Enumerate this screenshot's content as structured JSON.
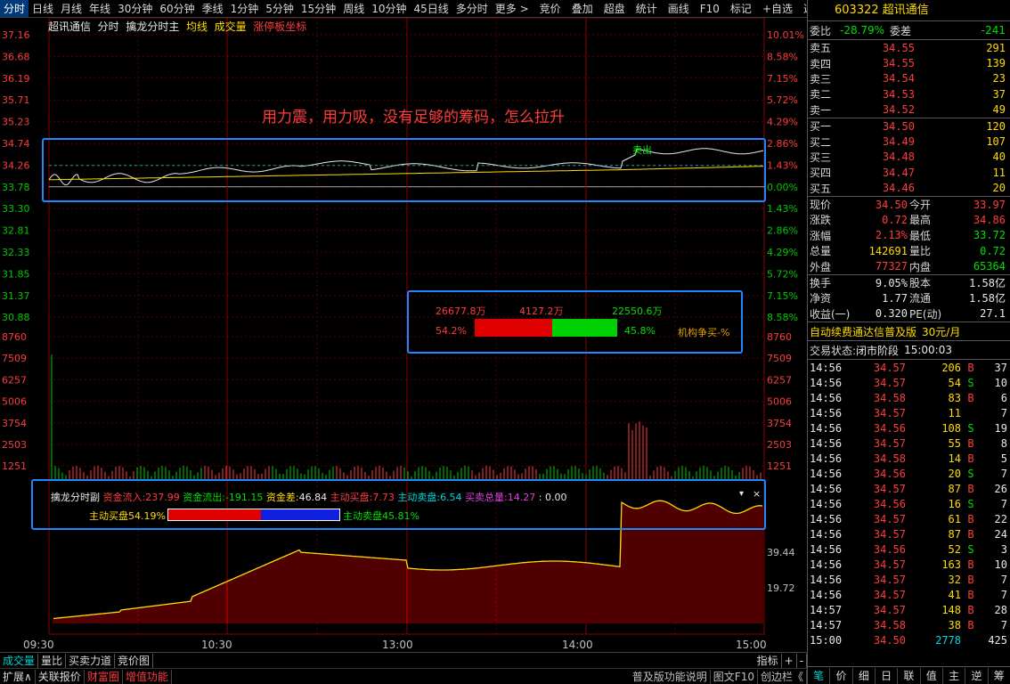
{
  "top_tabs": [
    "分时",
    "日线",
    "月线",
    "年线",
    "30分钟",
    "60分钟",
    "季线",
    "1分钟",
    "5分钟",
    "15分钟",
    "周线",
    "10分钟",
    "45日线",
    "多分时",
    "更多 >"
  ],
  "top_tools": [
    "竞价",
    "叠加",
    "超盘",
    "统计",
    "画线",
    "F10",
    "标记",
    "+自选",
    "返回"
  ],
  "info_bar": {
    "name": "超讯通信",
    "mode": "分时",
    "ind": "擒龙分时主",
    "avg": "均线",
    "vol": "成交量",
    "limit": "涨停板坐标"
  },
  "annotation_text": "用力震，用力吸，没有足够的筹码，怎么拉升",
  "price_axis_left": [
    "37.16",
    "36.68",
    "36.19",
    "35.71",
    "35.23",
    "34.74",
    "34.26",
    "33.78",
    "33.30",
    "32.81",
    "32.33",
    "31.85",
    "31.37",
    "30.88"
  ],
  "pct_axis_right": [
    "10.01%",
    "8.58%",
    "7.15%",
    "5.72%",
    "4.29%",
    "2.86%",
    "1.43%",
    "0.00%",
    "1.43%",
    "2.86%",
    "4.29%",
    "5.72%",
    "7.15%",
    "8.58%"
  ],
  "volume_axis": [
    "8760",
    "7509",
    "6257",
    "5006",
    "3754",
    "2503",
    "1251"
  ],
  "fund_axis": [
    "39.44",
    "19.72"
  ],
  "time_axis": [
    "09:30",
    "10:30",
    "13:00",
    "14:00",
    "15:00"
  ],
  "sell_label": "卖出",
  "flow_box": {
    "v1": "26677.8万",
    "v2": "4127.2万",
    "v3": "22550.6万",
    "p1": "54.2%",
    "p2": "45.8%",
    "note": "机构争买-%",
    "buy_frac": 0.542
  },
  "sub_panel": {
    "title": "擒龙分时副",
    "in_lbl": "资金流入:",
    "in_val": "237.99",
    "out_lbl": "资金流出:",
    "out_val": "-191.15",
    "diff_lbl": "资金差:",
    "diff_val": "46.84",
    "abuy_lbl": "主动买盘:",
    "abuy_val": "7.73",
    "asell_lbl": "主动卖盘:",
    "asell_val": "6.54",
    "total_lbl": "买卖总量:",
    "total_val": "14.27",
    "extra": ": 0.00",
    "buy_label": "主动买盘54.19%",
    "sell_label": "主动卖盘45.81%",
    "buy_frac": 0.5419
  },
  "bottom_tabs": [
    "成交量",
    "量比",
    "买卖力道",
    "竞价图"
  ],
  "bottom_right": [
    "指标",
    "+",
    "-"
  ],
  "status_left": [
    "扩展∧",
    "关联报价",
    "财富圈",
    "增值功能"
  ],
  "status_right": [
    "普及版功能说明",
    "图文F10",
    "创边栏《"
  ],
  "stock": {
    "code": "603322",
    "name": "超讯通信"
  },
  "webi": {
    "lbl": "委比",
    "val": "-28.79%",
    "lbl2": "委差",
    "val2": "-241"
  },
  "asks": [
    {
      "lbl": "卖五",
      "price": "34.55",
      "vol": "291"
    },
    {
      "lbl": "卖四",
      "price": "34.55",
      "vol": "139"
    },
    {
      "lbl": "卖三",
      "price": "34.54",
      "vol": "23"
    },
    {
      "lbl": "卖二",
      "price": "34.53",
      "vol": "37"
    },
    {
      "lbl": "卖一",
      "price": "34.52",
      "vol": "49"
    }
  ],
  "bids": [
    {
      "lbl": "买一",
      "price": "34.50",
      "vol": "120"
    },
    {
      "lbl": "买二",
      "price": "34.49",
      "vol": "107"
    },
    {
      "lbl": "买三",
      "price": "34.48",
      "vol": "40"
    },
    {
      "lbl": "买四",
      "price": "34.47",
      "vol": "11"
    },
    {
      "lbl": "买五",
      "price": "34.46",
      "vol": "20"
    }
  ],
  "quote": [
    {
      "l1": "现价",
      "v1": "34.50",
      "c1": "red",
      "l2": "今开",
      "v2": "33.97",
      "c2": "red"
    },
    {
      "l1": "涨跌",
      "v1": "0.72",
      "c1": "red",
      "l2": "最高",
      "v2": "34.86",
      "c2": "red"
    },
    {
      "l1": "涨幅",
      "v1": "2.13%",
      "c1": "red",
      "l2": "最低",
      "v2": "33.72",
      "c2": "green"
    },
    {
      "l1": "总量",
      "v1": "142691",
      "c1": "yellow",
      "l2": "量比",
      "v2": "0.72",
      "c2": "green"
    },
    {
      "l1": "外盘",
      "v1": "77327",
      "c1": "red",
      "l2": "内盘",
      "v2": "65364",
      "c2": "green"
    }
  ],
  "fin": [
    {
      "l1": "换手",
      "v1": "9.05%",
      "l2": "股本",
      "v2": "1.58亿"
    },
    {
      "l1": "净资",
      "v1": "1.77",
      "l2": "流通",
      "v2": "1.58亿"
    },
    {
      "l1": "收益(一)",
      "v1": "0.320",
      "l2": "PE(动)",
      "v2": "27.1"
    }
  ],
  "promo": {
    "text": "自动续费通达信普及版",
    "price": "30元/月"
  },
  "trade_state": {
    "lbl": "交易状态:",
    "state": "闭市阶段",
    "time": "15:00:03"
  },
  "ticks": [
    {
      "t": "14:56",
      "p": "34.57",
      "v": "206",
      "d": "B",
      "n": "37"
    },
    {
      "t": "14:56",
      "p": "34.57",
      "v": "54",
      "d": "S",
      "n": "10"
    },
    {
      "t": "14:56",
      "p": "34.58",
      "v": "83",
      "d": "B",
      "n": "6"
    },
    {
      "t": "14:56",
      "p": "34.57",
      "v": "11",
      "d": "",
      "n": "7"
    },
    {
      "t": "14:56",
      "p": "34.56",
      "v": "108",
      "d": "S",
      "n": "19"
    },
    {
      "t": "14:56",
      "p": "34.57",
      "v": "55",
      "d": "B",
      "n": "8"
    },
    {
      "t": "14:56",
      "p": "34.58",
      "v": "14",
      "d": "B",
      "n": "5"
    },
    {
      "t": "14:56",
      "p": "34.56",
      "v": "20",
      "d": "S",
      "n": "7"
    },
    {
      "t": "14:56",
      "p": "34.57",
      "v": "87",
      "d": "B",
      "n": "26"
    },
    {
      "t": "14:56",
      "p": "34.56",
      "v": "16",
      "d": "S",
      "n": "7"
    },
    {
      "t": "14:56",
      "p": "34.57",
      "v": "61",
      "d": "B",
      "n": "22"
    },
    {
      "t": "14:56",
      "p": "34.57",
      "v": "87",
      "d": "B",
      "n": "24"
    },
    {
      "t": "14:56",
      "p": "34.56",
      "v": "52",
      "d": "S",
      "n": "3"
    },
    {
      "t": "14:56",
      "p": "34.57",
      "v": "163",
      "d": "B",
      "n": "10"
    },
    {
      "t": "14:56",
      "p": "34.57",
      "v": "32",
      "d": "B",
      "n": "7"
    },
    {
      "t": "14:56",
      "p": "34.57",
      "v": "41",
      "d": "B",
      "n": "7"
    },
    {
      "t": "14:57",
      "p": "34.57",
      "v": "148",
      "d": "B",
      "n": "28"
    },
    {
      "t": "14:57",
      "p": "34.58",
      "v": "38",
      "d": "B",
      "n": "7"
    },
    {
      "t": "15:00",
      "p": "34.50",
      "v": "2778",
      "d": "",
      "n": "425"
    }
  ],
  "side_tabs": [
    "笔",
    "价",
    "细",
    "日",
    "联",
    "值",
    "主",
    "逆",
    "筹"
  ]
}
